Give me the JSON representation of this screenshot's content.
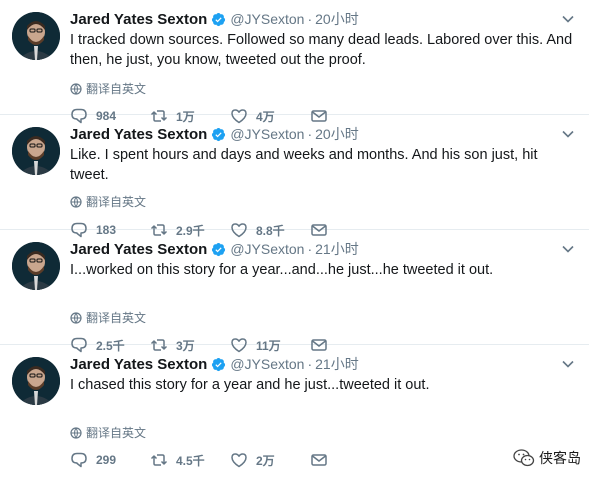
{
  "tweets": [
    {
      "name": "Jared Yates Sexton",
      "handle": "@JYSexton",
      "separator": "·",
      "time": "20小时",
      "text": "I tracked down sources. Followed so many dead leads. Labored over this. And then, he just, you know, tweeted out the proof.",
      "translate": "翻译自英文",
      "replies": "984",
      "retweets": "1万",
      "likes": "4万"
    },
    {
      "name": "Jared Yates Sexton",
      "handle": "@JYSexton",
      "separator": "·",
      "time": "20小时",
      "text": "Like. I spent hours and days and weeks and months. And his son just, hit tweet.",
      "translate": "翻译自英文",
      "replies": "183",
      "retweets": "2.9千",
      "likes": "8.8千"
    },
    {
      "name": "Jared Yates Sexton",
      "handle": "@JYSexton",
      "separator": "·",
      "time": "21小时",
      "text": "I...worked on this story for a year...and...he just...he tweeted it out.",
      "translate": "翻译自英文",
      "replies": "2.5千",
      "retweets": "3万",
      "likes": "11万"
    },
    {
      "name": "Jared Yates Sexton",
      "handle": "@JYSexton",
      "separator": "·",
      "time": "21小时",
      "text": "I chased this story for a year and he just...tweeted it out.",
      "translate": "翻译自英文",
      "replies": "299",
      "retweets": "4.5千",
      "likes": "2万"
    }
  ],
  "watermark": {
    "text": "侠客岛"
  },
  "colors": {
    "text": "#14171a",
    "muted": "#657786",
    "verified": "#1da1f2",
    "divider": "#e6ecf0"
  }
}
